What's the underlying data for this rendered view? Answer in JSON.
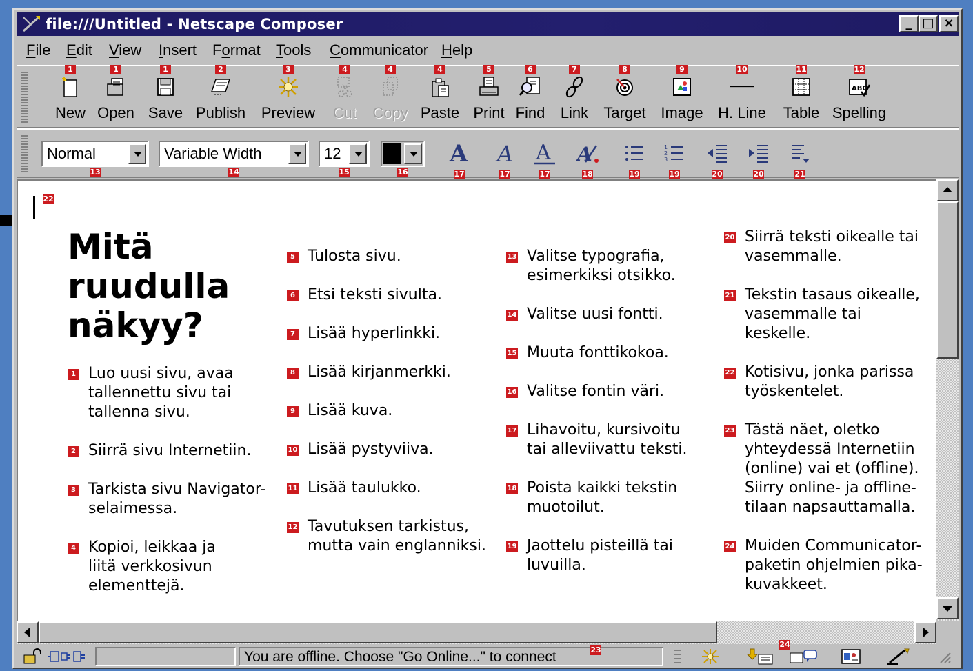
{
  "window": {
    "title": "file:///Untitled - Netscape Composer",
    "controls": {
      "minimize": "_",
      "maximize": "□",
      "close": "×"
    }
  },
  "menu": [
    {
      "label": "File",
      "key": "F",
      "rest": "ile"
    },
    {
      "label": "Edit",
      "key": "E",
      "rest": "dit"
    },
    {
      "label": "View",
      "key": "V",
      "rest": "iew"
    },
    {
      "label": "Insert",
      "key": "I",
      "rest": "nsert"
    },
    {
      "label": "Format",
      "pre": "F",
      "key": "o",
      "rest": "rmat"
    },
    {
      "label": "Tools",
      "key": "T",
      "rest": "ools"
    },
    {
      "label": "Communicator",
      "key": "C",
      "rest": "ommunicator"
    },
    {
      "label": "Help",
      "key": "H",
      "rest": "elp"
    }
  ],
  "toolbar": {
    "new": {
      "label": "New",
      "tag": "1",
      "icon": "new-page-icon"
    },
    "open": {
      "label": "Open",
      "tag": "1",
      "icon": "open-icon"
    },
    "save": {
      "label": "Save",
      "tag": "1",
      "icon": "save-icon"
    },
    "publish": {
      "label": "Publish",
      "tag": "2",
      "icon": "publish-icon"
    },
    "preview": {
      "label": "Preview",
      "tag": "3",
      "icon": "preview-icon"
    },
    "cut": {
      "label": "Cut",
      "tag": "4",
      "icon": "cut-icon",
      "disabled": true
    },
    "copy": {
      "label": "Copy",
      "tag": "4",
      "icon": "copy-icon",
      "disabled": true
    },
    "paste": {
      "label": "Paste",
      "tag": "4",
      "icon": "paste-icon"
    },
    "print": {
      "label": "Print",
      "tag": "5",
      "icon": "print-icon"
    },
    "find": {
      "label": "Find",
      "tag": "6",
      "icon": "find-icon"
    },
    "link": {
      "label": "Link",
      "tag": "7",
      "icon": "link-icon"
    },
    "target": {
      "label": "Target",
      "tag": "8",
      "icon": "target-icon"
    },
    "image": {
      "label": "Image",
      "tag": "9",
      "icon": "image-icon"
    },
    "hline": {
      "label": "H. Line",
      "tag": "10",
      "icon": "horizontal-line-icon"
    },
    "table": {
      "label": "Table",
      "tag": "11",
      "icon": "table-icon"
    },
    "spelling": {
      "label": "Spelling",
      "tag": "12",
      "icon": "spelling-icon"
    }
  },
  "format_bar": {
    "paragraph_style": {
      "value": "Normal",
      "tag": "13"
    },
    "font": {
      "value": "Variable Width",
      "tag": "14"
    },
    "size": {
      "value": "12",
      "tag": "15"
    },
    "color": {
      "value": "#000000",
      "tag": "16"
    },
    "bold": {
      "tag": "17",
      "icon": "bold-icon"
    },
    "italic": {
      "tag": "17",
      "icon": "italic-icon"
    },
    "underline": {
      "tag": "17",
      "icon": "underline-icon"
    },
    "clear_styles": {
      "tag": "18",
      "icon": "clear-styles-icon"
    },
    "bullet_list": {
      "tag": "19",
      "icon": "bullet-list-icon"
    },
    "numbered_list": {
      "tag": "19",
      "icon": "numbered-list-icon"
    },
    "outdent": {
      "tag": "20",
      "icon": "outdent-icon"
    },
    "indent": {
      "tag": "20",
      "icon": "indent-icon"
    },
    "align": {
      "tag": "21",
      "icon": "align-icon"
    }
  },
  "document": {
    "cursor_tag": "22",
    "headline_lines": [
      "Mitä",
      "ruudulla",
      "näkyy?"
    ],
    "col1": [
      {
        "n": "1",
        "lines": [
          "Luo uusi sivu, avaa",
          "tallennettu sivu tai",
          "tallenna sivu."
        ]
      },
      {
        "n": "2",
        "lines": [
          "Siirrä sivu Internetiin."
        ]
      },
      {
        "n": "3",
        "lines": [
          "Tarkista sivu Navigator-",
          "selaimessa."
        ]
      },
      {
        "n": "4",
        "lines": [
          "Kopioi, leikkaa ja",
          "liitä verkkosivun",
          "elementtejä."
        ]
      }
    ],
    "col2": [
      {
        "n": "5",
        "lines": [
          "Tulosta sivu."
        ]
      },
      {
        "n": "6",
        "lines": [
          "Etsi teksti sivulta."
        ]
      },
      {
        "n": "7",
        "lines": [
          "Lisää hyperlinkki."
        ]
      },
      {
        "n": "8",
        "lines": [
          "Lisää kirjanmerkki."
        ]
      },
      {
        "n": "9",
        "lines": [
          "Lisää kuva."
        ]
      },
      {
        "n": "10",
        "lines": [
          "Lisää pystyviiva."
        ]
      },
      {
        "n": "11",
        "lines": [
          "Lisää taulukko."
        ]
      },
      {
        "n": "12",
        "lines": [
          "Tavutuksen tarkistus,",
          "mutta vain englanniksi."
        ]
      }
    ],
    "col3": [
      {
        "n": "13",
        "lines": [
          "Valitse typografia,",
          "esimerkiksi otsikko."
        ]
      },
      {
        "n": "14",
        "lines": [
          "Valitse uusi fontti."
        ]
      },
      {
        "n": "15",
        "lines": [
          "Muuta fonttikokoa."
        ]
      },
      {
        "n": "16",
        "lines": [
          "Valitse fontin väri."
        ]
      },
      {
        "n": "17",
        "lines": [
          "Lihavoitu, kursivoitu",
          "tai alleviivattu teksti."
        ]
      },
      {
        "n": "18",
        "lines": [
          "Poista kaikki tekstin",
          "muotoilut."
        ]
      },
      {
        "n": "19",
        "lines": [
          "Jaottelu pisteillä tai",
          "luvuilla."
        ]
      }
    ],
    "col4": [
      {
        "n": "20",
        "lines": [
          "Siirrä teksti oikealle tai",
          "vasemmalle."
        ]
      },
      {
        "n": "21",
        "lines": [
          "Tekstin tasaus oikealle,",
          "vasemmalle tai",
          "keskelle."
        ]
      },
      {
        "n": "22",
        "lines": [
          "Kotisivu, jonka parissa",
          "työskentelet."
        ]
      },
      {
        "n": "23",
        "lines": [
          "Tästä näet, oletko",
          "yhteydessä Internetiin",
          "(online) vai et (offline).",
          "Siirry online- ja offline-",
          "tilaan napsauttamalla."
        ]
      },
      {
        "n": "24",
        "lines": [
          "Muiden Communicator-",
          "paketin ohjelmien pika-",
          "kuvakkeet."
        ]
      }
    ]
  },
  "statusbar": {
    "message": "You are offline. Choose \"Go Online...\" to connect",
    "message_tag": "23",
    "shortcuts_tag": "24"
  },
  "colors": {
    "tag_red": "#cc1b1f",
    "title_blue": "#231f6e",
    "chrome": "#c0c0c0"
  }
}
